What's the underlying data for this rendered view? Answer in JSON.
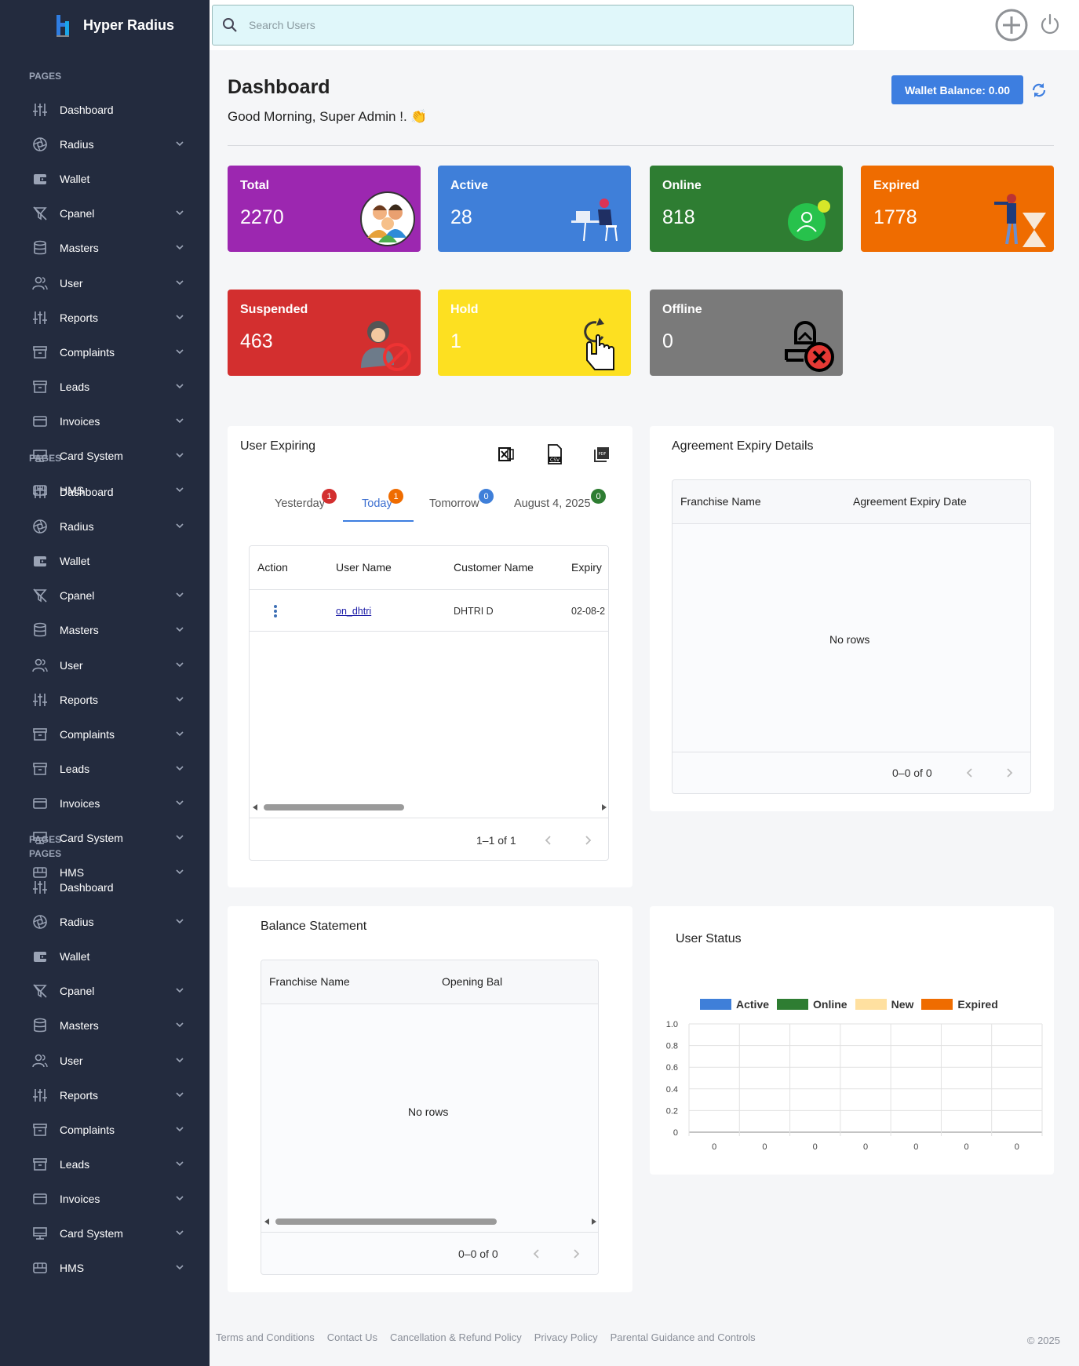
{
  "brand": {
    "name": "Hyper Radius"
  },
  "nav_section_label": "PAGES",
  "nav_items": [
    {
      "label": "Dashboard",
      "icon": "sliders-icon",
      "chevron": false
    },
    {
      "label": "Radius",
      "icon": "aperture-icon",
      "chevron": true
    },
    {
      "label": "Wallet",
      "icon": "wallet-icon",
      "chevron": false
    },
    {
      "label": "Cpanel",
      "icon": "filter-icon",
      "chevron": true
    },
    {
      "label": "Masters",
      "icon": "database-icon",
      "chevron": true
    },
    {
      "label": "User",
      "icon": "users-icon",
      "chevron": true
    },
    {
      "label": "Reports",
      "icon": "sliders-icon",
      "chevron": true
    },
    {
      "label": "Complaints",
      "icon": "archive-icon",
      "chevron": true
    },
    {
      "label": "Leads",
      "icon": "archive-icon",
      "chevron": true
    },
    {
      "label": "Invoices",
      "icon": "credit-card-icon",
      "chevron": true
    },
    {
      "label": "Card System",
      "icon": "monitor-icon",
      "chevron": true
    },
    {
      "label": "HMS",
      "icon": "hotel-icon",
      "chevron": true
    }
  ],
  "search": {
    "placeholder": "Search Users"
  },
  "dashboard": {
    "title": "Dashboard",
    "greeting": "Good Morning, Super Admin !. 👏",
    "wallet_label": "Wallet Balance: 0.00"
  },
  "cards": [
    {
      "title": "Total",
      "value": "2270",
      "color": "#9c27b0"
    },
    {
      "title": "Active",
      "value": "28",
      "color": "#3f7fd9"
    },
    {
      "title": "Online",
      "value": "818",
      "color": "#2e7d32"
    },
    {
      "title": "Expired",
      "value": "1778",
      "color": "#ef6c00"
    },
    {
      "title": "Suspended",
      "value": "463",
      "color": "#d32f2f"
    },
    {
      "title": "Hold",
      "value": "1",
      "color": "#fde021"
    },
    {
      "title": "Offline",
      "value": "0",
      "color": "#7a7a7a"
    }
  ],
  "user_expiring": {
    "title": "User Expiring",
    "tabs": [
      {
        "label": "Yesterday",
        "count": "1",
        "badge_color": "#d32f2f"
      },
      {
        "label": "Today",
        "count": "1",
        "badge_color": "#ef6c00"
      },
      {
        "label": "Tomorrow",
        "count": "0",
        "badge_color": "#3f7fd9"
      },
      {
        "label": "August 4, 2025",
        "count": "0",
        "badge_color": "#2e7d32"
      }
    ],
    "columns": [
      "Action",
      "User Name",
      "Customer Name",
      "Expiry"
    ],
    "rows": [
      {
        "user_name": "on_dhtri",
        "customer_name": "DHTRI D",
        "expiry": "02-08-2"
      }
    ],
    "pagination": "1–1 of 1"
  },
  "agreement": {
    "title": "Agreement Expiry Details",
    "columns": [
      "Franchise Name",
      "Agreement Expiry Date"
    ],
    "empty": "No rows",
    "pagination": "0–0 of 0"
  },
  "balance": {
    "title": "Balance Statement",
    "columns": [
      "Franchise Name",
      "Opening Bal"
    ],
    "empty": "No rows",
    "pagination": "0–0 of 0"
  },
  "user_status": {
    "title": "User Status"
  },
  "chart_data": {
    "type": "bar",
    "title": "",
    "series": [
      {
        "name": "Active",
        "color": "#3f7fd9",
        "values": [
          0,
          0,
          0,
          0,
          0,
          0,
          0
        ]
      },
      {
        "name": "Online",
        "color": "#2e7d32",
        "values": [
          0,
          0,
          0,
          0,
          0,
          0,
          0
        ]
      },
      {
        "name": "New",
        "color": "#ffe0a0",
        "values": [
          0,
          0,
          0,
          0,
          0,
          0,
          0
        ]
      },
      {
        "name": "Expired",
        "color": "#ef6c00",
        "values": [
          0,
          0,
          0,
          0,
          0,
          0,
          0
        ]
      }
    ],
    "categories": [
      "0",
      "0",
      "0",
      "0",
      "0",
      "0",
      "0"
    ],
    "yticks": [
      "1.0",
      "0.8",
      "0.6",
      "0.4",
      "0.2",
      "0"
    ],
    "ylim": [
      0,
      1
    ],
    "grid": true,
    "legend": "top"
  },
  "footer": {
    "links": [
      "Terms and Conditions",
      "Contact Us",
      "Cancellation & Refund Policy",
      "Privacy Policy",
      "Parental Guidance and Controls"
    ],
    "copyright": "© 2025"
  }
}
